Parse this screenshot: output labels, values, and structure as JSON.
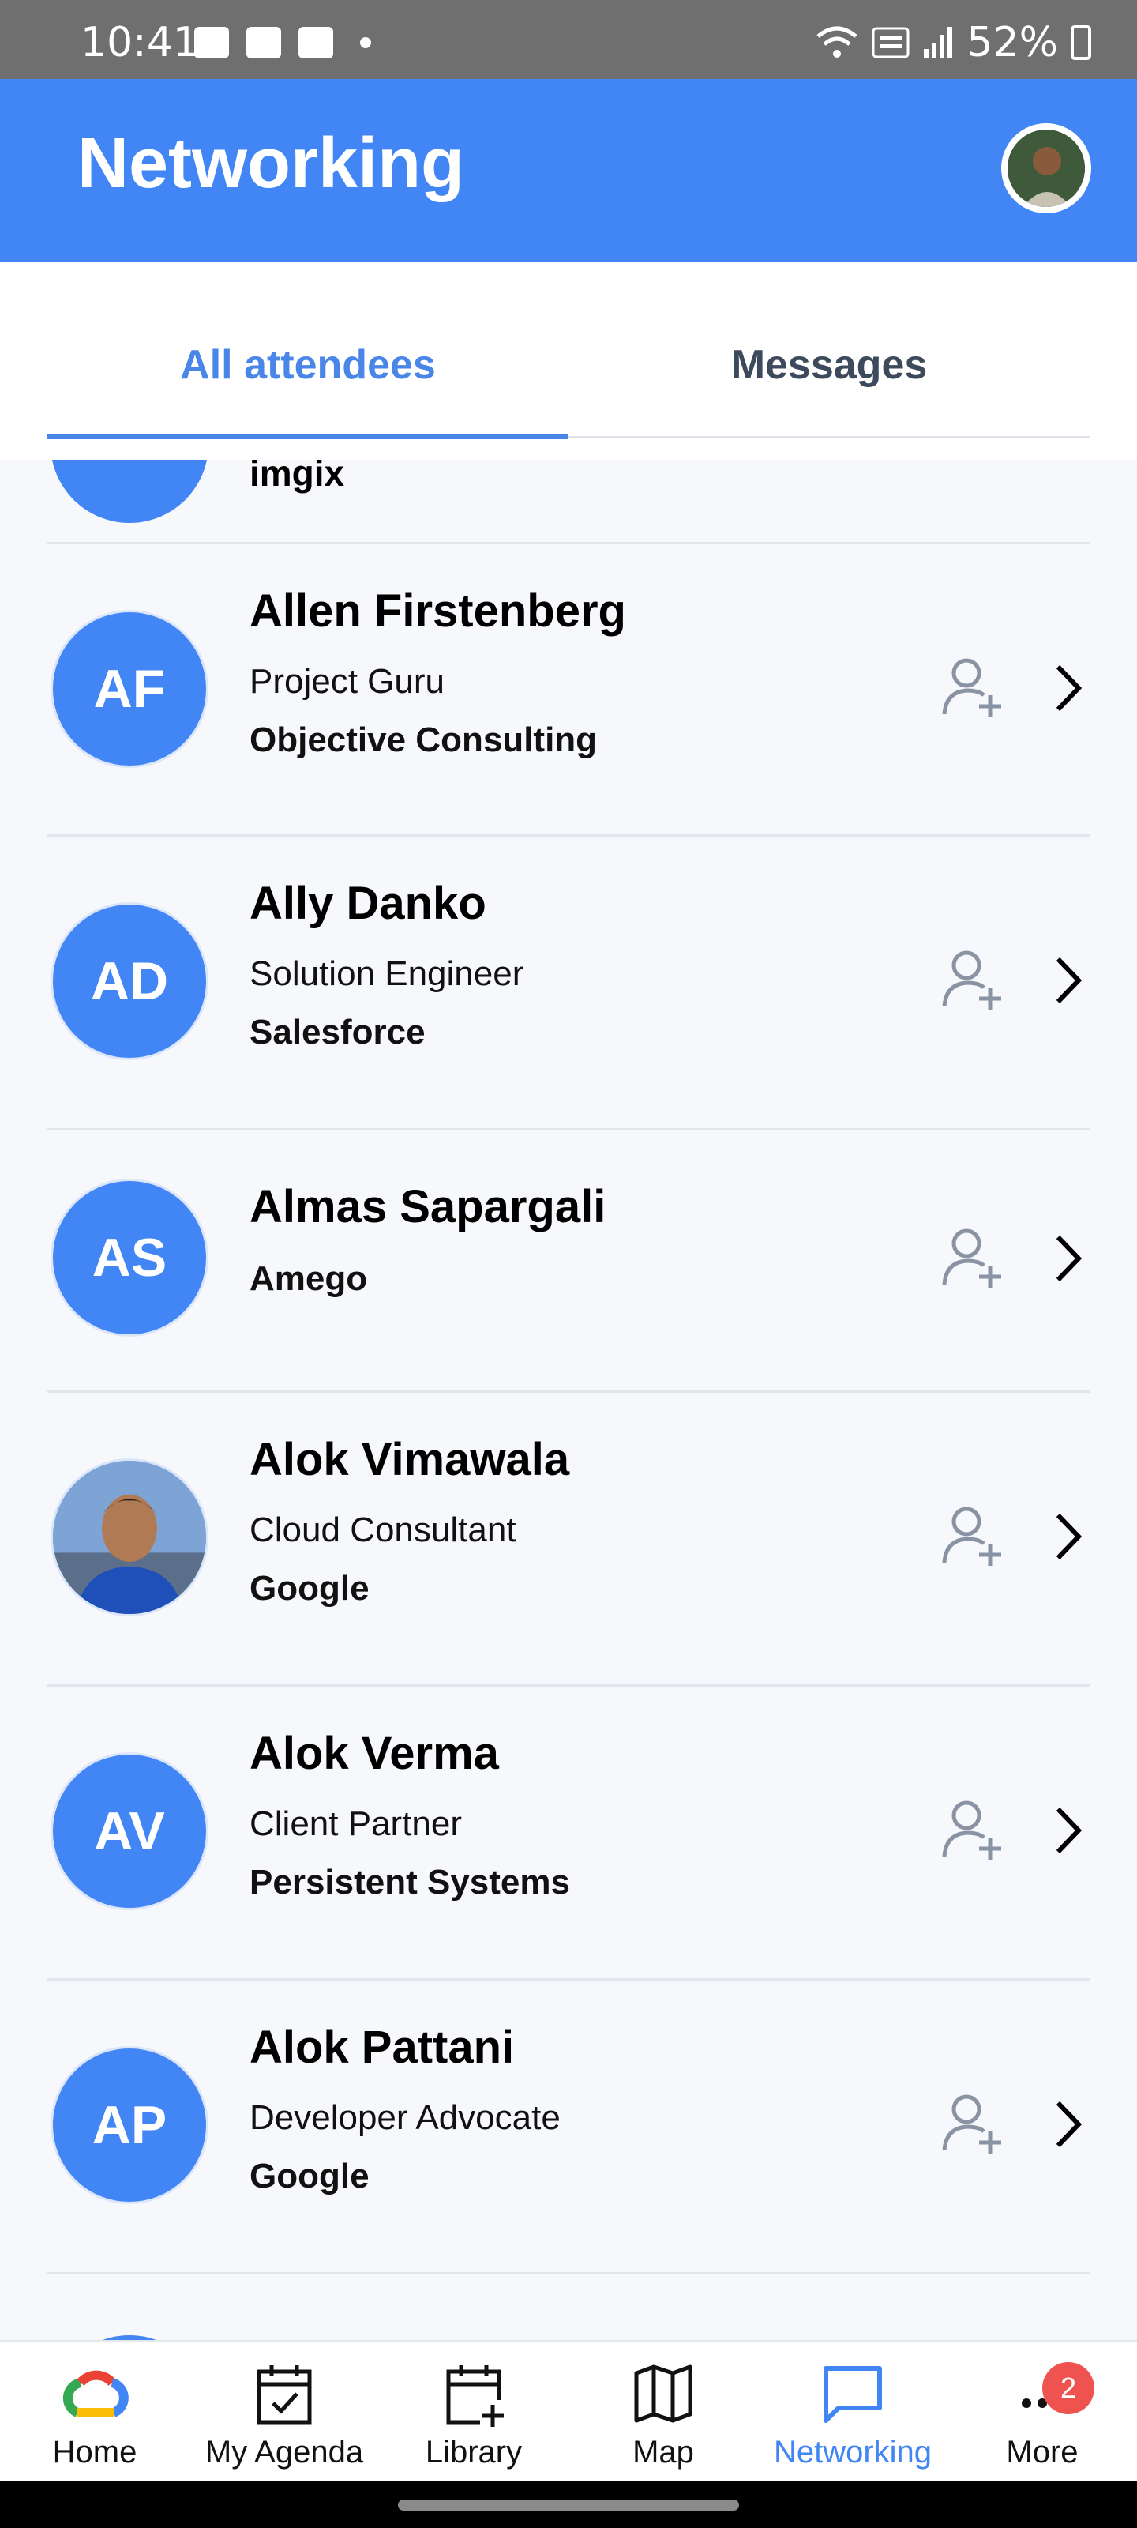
{
  "status_bar": {
    "time": "10:41",
    "battery": "52%",
    "network": "VoLTE"
  },
  "app_bar": {
    "title": "Networking"
  },
  "tabs": [
    {
      "label": "All attendees",
      "active": true
    },
    {
      "label": "Messages",
      "active": false
    }
  ],
  "partial_top_item": {
    "company": "imgix"
  },
  "attendees": [
    {
      "initials": "AF",
      "name": "Allen Firstenberg",
      "title": "Project Guru",
      "company": "Objective Consulting"
    },
    {
      "initials": "AD",
      "name": "Ally Danko",
      "title": "Solution Engineer",
      "company": "Salesforce"
    },
    {
      "initials": "AS",
      "name": "Almas Sapargali",
      "title": "",
      "company": "Amego"
    },
    {
      "initials": "",
      "name": "Alok Vimawala",
      "title": "Cloud Consultant",
      "company": "Google",
      "photo": true
    },
    {
      "initials": "AV",
      "name": "Alok Verma",
      "title": "Client Partner",
      "company": "Persistent Systems"
    },
    {
      "initials": "AP",
      "name": "Alok Pattani",
      "title": "Developer Advocate",
      "company": "Google"
    }
  ],
  "bottom_nav": [
    {
      "label": "Home",
      "icon": "google-cloud-logo-icon",
      "active": false
    },
    {
      "label": "My Agenda",
      "icon": "calendar-check-icon",
      "active": false
    },
    {
      "label": "Library",
      "icon": "calendar-plus-icon",
      "active": false
    },
    {
      "label": "Map",
      "icon": "map-icon",
      "active": false
    },
    {
      "label": "Networking",
      "icon": "chat-icon",
      "active": true
    },
    {
      "label": "More",
      "icon": "more-dots-icon",
      "active": false
    }
  ],
  "more_badge": "2",
  "colors": {
    "primary": "#4285f4",
    "tab_active": "#4a86e8",
    "badge": "#ef5350"
  }
}
